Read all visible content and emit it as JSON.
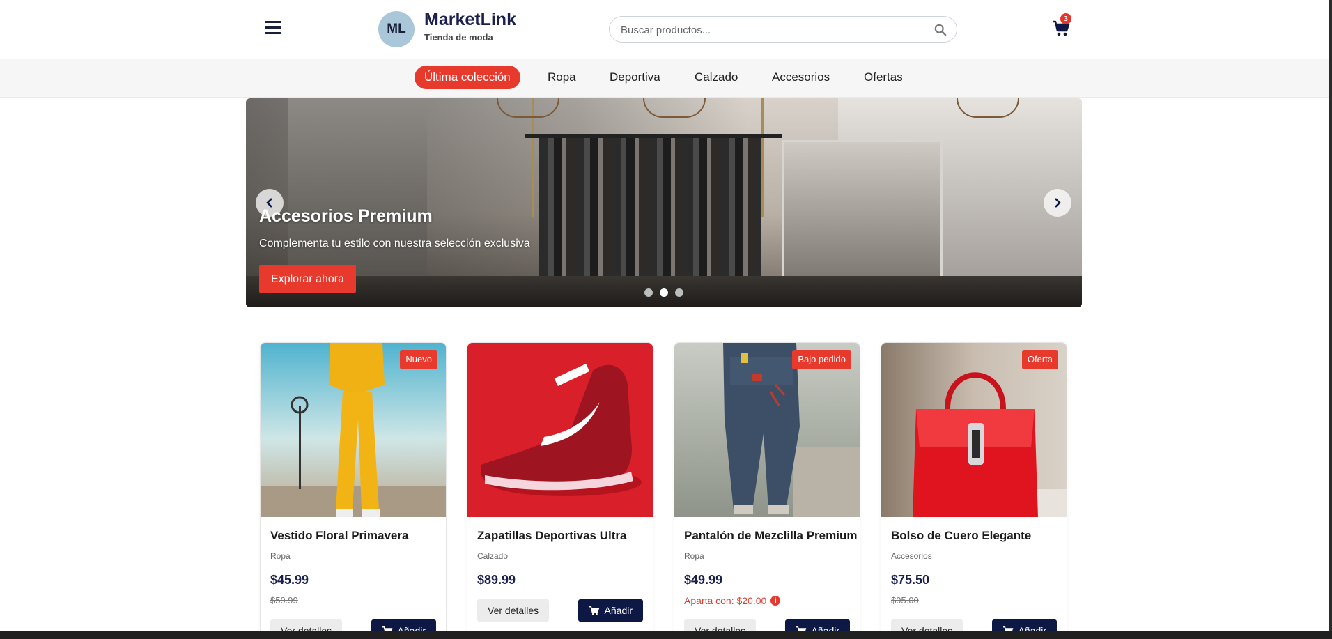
{
  "header": {
    "logo_initials": "ML",
    "brand_name": "MarketLink",
    "brand_tagline": "Tienda de moda",
    "search_placeholder": "Buscar productos...",
    "cart_count": "3"
  },
  "categories": [
    {
      "label": "Última colección",
      "active": true
    },
    {
      "label": "Ropa",
      "active": false
    },
    {
      "label": "Deportiva",
      "active": false
    },
    {
      "label": "Calzado",
      "active": false
    },
    {
      "label": "Accesorios",
      "active": false
    },
    {
      "label": "Ofertas",
      "active": false
    }
  ],
  "hero": {
    "title": "Accesorios Premium",
    "subtitle": "Complementa tu estilo con nuestra selección exclusiva",
    "cta_label": "Explorar ahora",
    "slides": 3,
    "active_slide": 2
  },
  "products": [
    {
      "name": "Vestido Floral Primavera",
      "category": "Ropa",
      "price": "$45.99",
      "old_price": "$59.99",
      "badge": "Nuevo",
      "details_label": "Ver detalles",
      "add_label": "Añadir"
    },
    {
      "name": "Zapatillas Deportivas Ultra",
      "category": "Calzado",
      "price": "$89.99",
      "details_label": "Ver detalles",
      "add_label": "Añadir"
    },
    {
      "name": "Pantalón de Mezclilla Premium",
      "category": "Ropa",
      "price": "$49.99",
      "deposit": "Aparta con: $20.00",
      "badge": "Bajo pedido",
      "details_label": "Ver detalles",
      "add_label": "Añadir"
    },
    {
      "name": "Bolso de Cuero Elegante",
      "category": "Accesorios",
      "price": "$75.50",
      "old_price": "$95.00",
      "badge": "Oferta",
      "details_label": "Ver detalles",
      "add_label": "Añadir"
    }
  ],
  "colors": {
    "accent": "#e8392d",
    "primary": "#0e1845",
    "brand_text": "#1a1f4d"
  }
}
